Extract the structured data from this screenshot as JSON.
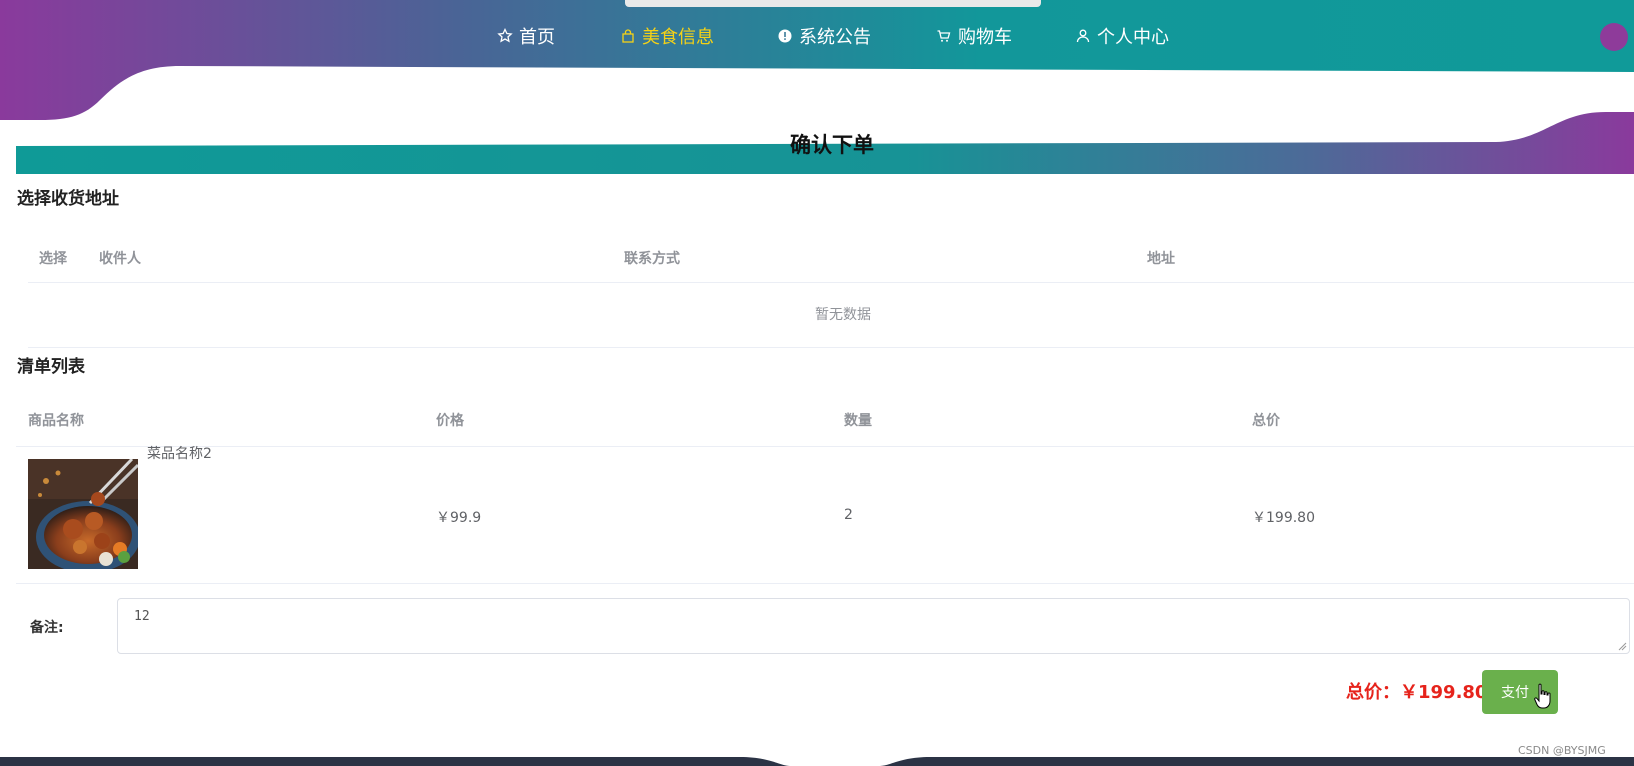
{
  "nav": {
    "items": [
      {
        "label": "首页",
        "icon": "star-icon"
      },
      {
        "label": "美食信息",
        "icon": "bag-icon",
        "active": true
      },
      {
        "label": "系统公告",
        "icon": "alert-icon"
      },
      {
        "label": "购物车",
        "icon": "cart-icon"
      },
      {
        "label": "个人中心",
        "icon": "user-icon"
      }
    ]
  },
  "page": {
    "title": "确认下单"
  },
  "address": {
    "section_title": "选择收货地址",
    "columns": [
      "选择",
      "收件人",
      "联系方式",
      "地址"
    ],
    "empty_text": "暂无数据"
  },
  "order": {
    "section_title": "清单列表",
    "columns": [
      "商品名称",
      "价格",
      "数量",
      "总价"
    ],
    "rows": [
      {
        "name": "菜品名称2",
        "price": "￥99.9",
        "quantity": "2",
        "total": "￥199.80"
      }
    ]
  },
  "remark": {
    "label": "备注:",
    "value": "12"
  },
  "summary": {
    "total_label": "总价：￥199.80",
    "pay_label": "支付"
  },
  "watermark": "CSDN @BYSJMG",
  "colors": {
    "purple": "#8a3a9c",
    "teal": "#0f9a97",
    "active_nav": "#f5d216",
    "total_red": "#e6231b",
    "pay_green": "#6ab04c"
  }
}
